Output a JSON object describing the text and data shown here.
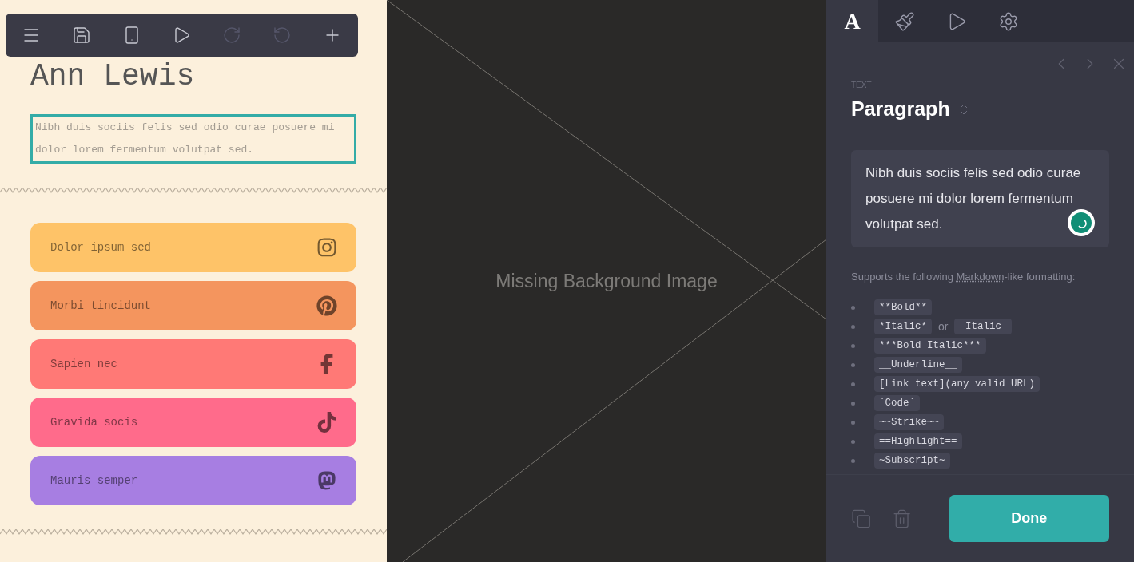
{
  "toolbar": [
    {
      "disabled": false
    },
    {
      "disabled": false
    },
    {
      "disabled": false
    },
    {
      "disabled": false
    },
    {
      "disabled": true
    },
    {
      "disabled": true
    },
    {
      "disabled": false
    }
  ],
  "page": {
    "title": "Ann Lewis",
    "paragraph": "Nibh duis sociis felis sed odio curae posuere mi dolor lorem fermentum volutpat sed.",
    "selected": true,
    "links": [
      {
        "label": "Dolor ipsum sed",
        "color": "#fec368"
      },
      {
        "label": "Morbi tincidunt",
        "color": "#f4955e"
      },
      {
        "label": "Sapien nec",
        "color": "#ff7976"
      },
      {
        "label": "Gravida socis",
        "color": "#ff6b8b"
      },
      {
        "label": "Mauris semper",
        "color": "#a77ee2"
      }
    ]
  },
  "canvas": {
    "message": "Missing Background Image"
  },
  "panel": {
    "tabs": [
      {
        "label": "A",
        "selected": true
      },
      {
        "selected": false
      },
      {
        "selected": false
      },
      {
        "selected": false
      }
    ],
    "section_label": "TEXT",
    "element_type": "Paragraph",
    "text_value": "Nibh duis sociis felis sed odio curae posuere mi dolor lorem fermentum volutpat sed.",
    "help": {
      "before": "Supports the following ",
      "term": "Markdown",
      "after": "-like formatting:"
    },
    "formats": [
      {
        "parts": [
          {
            "kind": "code",
            "text": "**Bold**"
          }
        ]
      },
      {
        "parts": [
          {
            "kind": "code",
            "text": "*Italic*"
          },
          {
            "kind": "word",
            "text": "or"
          },
          {
            "kind": "code",
            "text": "_Italic_"
          }
        ]
      },
      {
        "parts": [
          {
            "kind": "code",
            "text": "***Bold Italic***"
          }
        ]
      },
      {
        "parts": [
          {
            "kind": "code",
            "text": "__Underline__"
          }
        ]
      },
      {
        "parts": [
          {
            "kind": "code",
            "text": "[Link text](any valid URL)"
          }
        ]
      },
      {
        "parts": [
          {
            "kind": "code",
            "text": "`Code`"
          }
        ]
      },
      {
        "parts": [
          {
            "kind": "code",
            "text": "~~Strike~~"
          }
        ]
      },
      {
        "parts": [
          {
            "kind": "code",
            "text": "==Highlight=="
          }
        ]
      },
      {
        "parts": [
          {
            "kind": "code",
            "text": "~Subscript~"
          }
        ]
      }
    ],
    "done": "Done"
  }
}
